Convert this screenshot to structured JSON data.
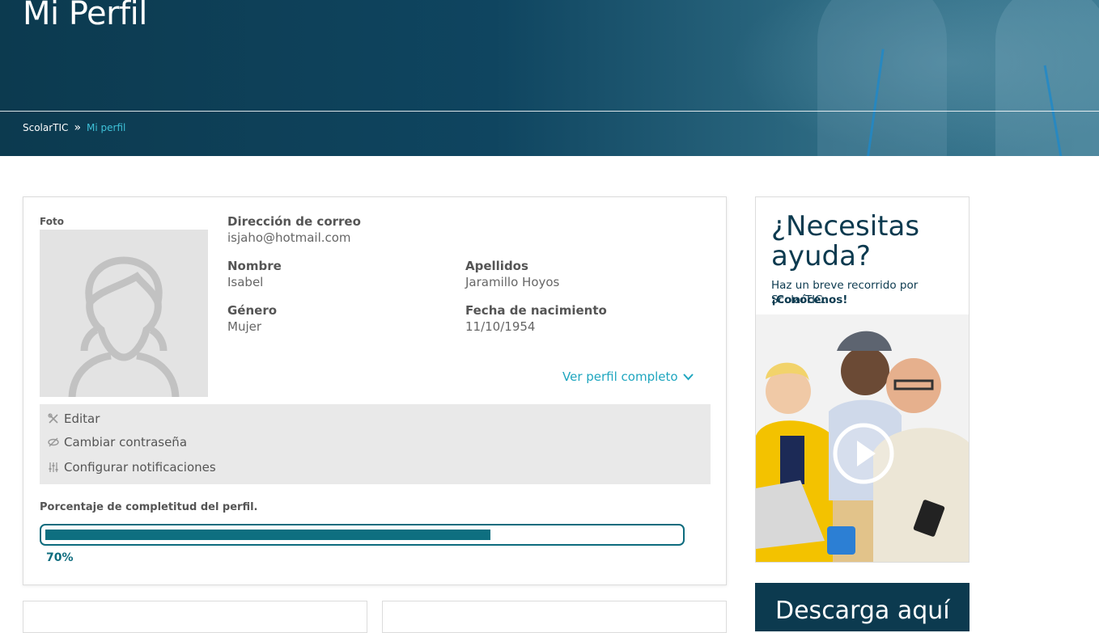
{
  "header": {
    "title": "Mi Perfil",
    "breadcrumb": {
      "home": "ScolarTIC",
      "separator": "»",
      "current": "Mi perfil"
    }
  },
  "profile": {
    "foto_label": "Foto",
    "email": {
      "label": "Dirección de correo",
      "value": "isjaho@hotmail.com"
    },
    "nombre": {
      "label": "Nombre",
      "value": "Isabel"
    },
    "apellidos": {
      "label": "Apellidos",
      "value": "Jaramillo Hoyos"
    },
    "genero": {
      "label": "Género",
      "value": "Mujer"
    },
    "fecha": {
      "label": "Fecha de nacimiento",
      "value": "11/10/1954"
    },
    "ver_perfil": "Ver perfil completo",
    "actions": {
      "editar": "Editar",
      "cambiar": "Cambiar contraseña",
      "configurar": "Configurar notificaciones"
    },
    "progress": {
      "label": "Porcentaje de completitud del perfil.",
      "value": 70,
      "text": "70%"
    }
  },
  "help": {
    "title": "¿Necesitas ayuda?",
    "text": "Haz un breve recorrido por ScolarTIC.",
    "link": "¡Conócenos!"
  },
  "download": {
    "title": "Descarga aquí"
  },
  "colors": {
    "banner": "#0f4560",
    "accent": "#1fa6bf",
    "progress": "#0e6f80",
    "dark_blue": "#0c3a4f"
  }
}
